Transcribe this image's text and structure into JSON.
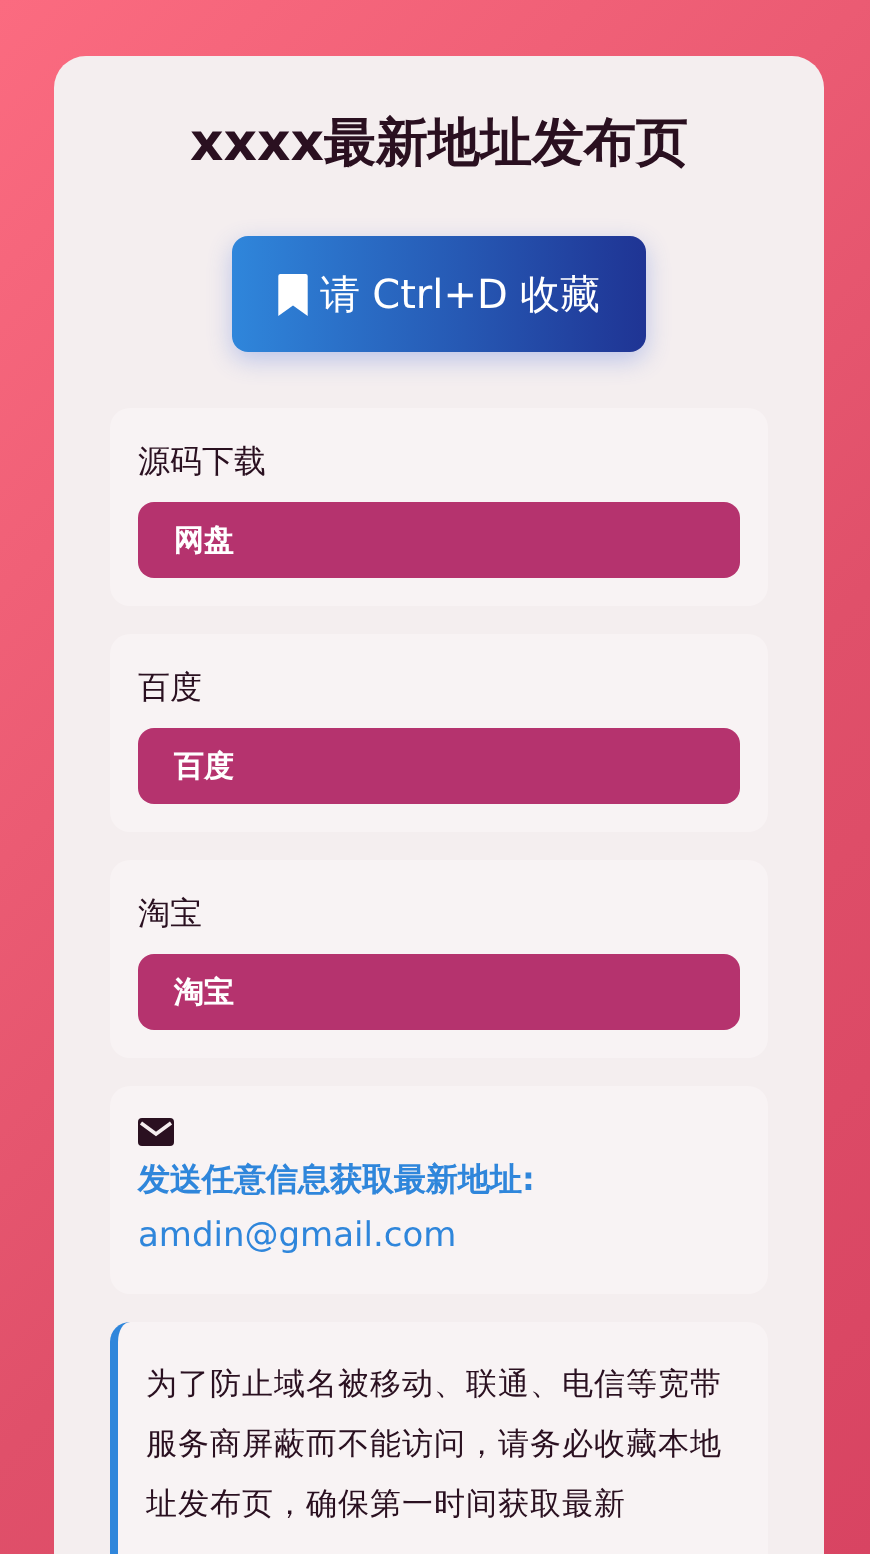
{
  "title": "xxxx最新地址发布页",
  "bookmark_button": {
    "label": "请 Ctrl+D 收藏"
  },
  "links": [
    {
      "label": "源码下载",
      "button": "网盘"
    },
    {
      "label": "百度",
      "button": "百度"
    },
    {
      "label": "淘宝",
      "button": "淘宝"
    }
  ],
  "contact": {
    "prompt": "发送任意信息获取最新地址:",
    "email": "amdin@gmail.com"
  },
  "notice": "为了防止域名被移动、联通、电信等宽带服务商屏蔽而不能访问，请务必收藏本地址发布页，确保第一时间获取最新"
}
